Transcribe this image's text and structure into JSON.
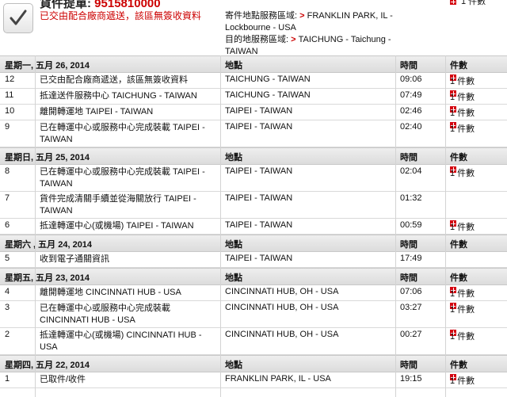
{
  "header": {
    "waybill_label": "貨件提單:",
    "waybill_number": "9515810000",
    "status_text": "已交由配合廠商遞送，該區無簽收資料",
    "origin_label": "寄件地點服務區域:",
    "origin_value": "FRANKLIN PARK, IL - Lockbourne - USA",
    "destination_label": "目的地服務區域:",
    "destination_value": "TAICHUNG - Taichung - TAIWAN",
    "arrow": ">",
    "pieces_text": "1 件數"
  },
  "columns": {
    "location": "地點",
    "time": "時間",
    "pieces": "件數"
  },
  "days": [
    {
      "date": "星期一, 五月 26, 2014",
      "events": [
        {
          "num": "12",
          "desc": "已交由配合廠商遞送，該區無簽收資料",
          "loc": "TAICHUNG - TAIWAN",
          "time": "09:06",
          "pcs": "1 件數"
        },
        {
          "num": "11",
          "desc": "抵達送件服務中心 TAICHUNG - TAIWAN",
          "loc": "TAICHUNG - TAIWAN",
          "time": "07:49",
          "pcs": "1 件數"
        },
        {
          "num": "10",
          "desc": "離開轉運地 TAIPEI - TAIWAN",
          "loc": "TAIPEI - TAIWAN",
          "time": "02:46",
          "pcs": "1 件數"
        },
        {
          "num": "9",
          "desc": "已在轉運中心或服務中心完成裝載 TAIPEI - TAIWAN",
          "loc": "TAIPEI - TAIWAN",
          "time": "02:40",
          "pcs": "1 件數"
        }
      ]
    },
    {
      "date": "星期日, 五月 25, 2014",
      "events": [
        {
          "num": "8",
          "desc": "已在轉運中心或服務中心完成裝載 TAIPEI - TAIWAN",
          "loc": "TAIPEI - TAIWAN",
          "time": "02:04",
          "pcs": "1 件數"
        },
        {
          "num": "7",
          "desc": "貨件完成清關手續並從海關放行 TAIPEI - TAIWAN",
          "loc": "TAIPEI - TAIWAN",
          "time": "01:32",
          "pcs": ""
        },
        {
          "num": "6",
          "desc": "抵達轉運中心(或機場) TAIPEI - TAIWAN",
          "loc": "TAIPEI - TAIWAN",
          "time": "00:59",
          "pcs": "1 件數"
        }
      ]
    },
    {
      "date": "星期六 , 五月 24, 2014",
      "events": [
        {
          "num": "5",
          "desc": "收到電子通關資訊",
          "loc": "TAIPEI - TAIWAN",
          "time": "17:49",
          "pcs": ""
        }
      ]
    },
    {
      "date": "星期五, 五月 23, 2014",
      "events": [
        {
          "num": "4",
          "desc": "離開轉運地 CINCINNATI HUB - USA",
          "loc": "CINCINNATI HUB, OH - USA",
          "time": "07:06",
          "pcs": "1 件數"
        },
        {
          "num": "3",
          "desc": "已在轉運中心或服務中心完成裝載 CINCINNATI HUB - USA",
          "loc": "CINCINNATI HUB, OH - USA",
          "time": "03:27",
          "pcs": "1 件數"
        },
        {
          "num": "2",
          "desc": "抵達轉運中心(或機場) CINCINNATI HUB - USA",
          "loc": "CINCINNATI HUB, OH - USA",
          "time": "00:27",
          "pcs": "1 件數"
        }
      ]
    },
    {
      "date": "星期四, 五月 22, 2014",
      "events": [
        {
          "num": "1",
          "desc": "已取件/收件",
          "loc": "FRANKLIN PARK, IL - USA",
          "time": "19:15",
          "pcs": "1 件數"
        }
      ]
    }
  ]
}
